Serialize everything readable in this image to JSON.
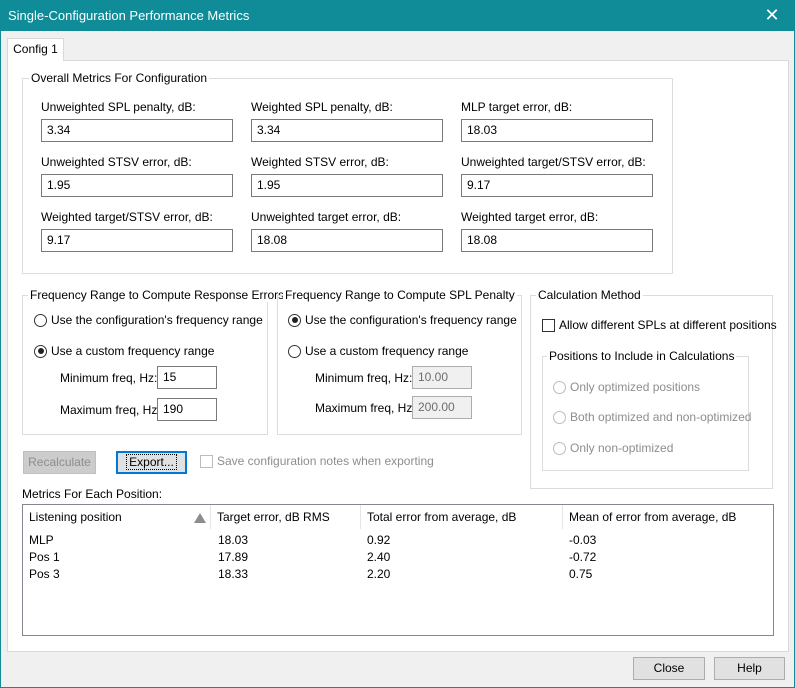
{
  "window": {
    "title": "Single-Configuration Performance Metrics",
    "close_glyph": "✕"
  },
  "tabs": [
    {
      "label": "Config 1"
    }
  ],
  "overall": {
    "legend": "Overall Metrics For Configuration",
    "fields": [
      {
        "label": "Unweighted SPL penalty, dB:",
        "value": "3.34"
      },
      {
        "label": "Weighted SPL penalty, dB:",
        "value": "3.34"
      },
      {
        "label": "MLP target error, dB:",
        "value": "18.03"
      },
      {
        "label": "Unweighted STSV error, dB:",
        "value": "1.95"
      },
      {
        "label": "Weighted STSV error, dB:",
        "value": "1.95"
      },
      {
        "label": "Unweighted target/STSV error, dB:",
        "value": "9.17"
      },
      {
        "label": "Weighted target/STSV error, dB:",
        "value": "9.17"
      },
      {
        "label": "Unweighted target error, dB:",
        "value": "18.08"
      },
      {
        "label": "Weighted target error, dB:",
        "value": "18.08"
      }
    ]
  },
  "resp_range": {
    "legend": "Frequency Range to Compute Response Errors",
    "opt1": "Use the configuration's frequency range",
    "opt2": "Use a custom frequency range",
    "min_label": "Minimum freq, Hz:",
    "min_value": "15",
    "max_label": "Maximum freq, Hz:",
    "max_value": "190"
  },
  "spl_range": {
    "legend": "Frequency Range to Compute SPL Penalty",
    "opt1": "Use the configuration's frequency range",
    "opt2": "Use a custom frequency range",
    "min_label": "Minimum freq, Hz:",
    "min_value": "10.00",
    "max_label": "Maximum freq, Hz:",
    "max_value": "200.00"
  },
  "calc": {
    "legend": "Calculation Method",
    "allow_label": "Allow different SPLs at different positions",
    "positions_legend": "Positions to Include in Calculations",
    "p1": "Only optimized positions",
    "p2": "Both optimized and non-optimized",
    "p3": "Only non-optimized"
  },
  "actions": {
    "recalculate": "Recalculate",
    "export": "Export...",
    "save_notes": "Save configuration notes when exporting"
  },
  "positions": {
    "title": "Metrics For Each Position:",
    "columns": [
      "Listening position",
      "Target error, dB RMS",
      "Total error from average, dB",
      "Mean of error from average, dB"
    ],
    "rows": [
      [
        "MLP",
        "18.03",
        "0.92",
        "-0.03"
      ],
      [
        "Pos 1",
        "17.89",
        "2.40",
        "-0.72"
      ],
      [
        "Pos 3",
        "18.33",
        "2.20",
        "0.75"
      ]
    ]
  },
  "footer": {
    "close": "Close",
    "help": "Help"
  },
  "colors": {
    "titlebar": "#0f8c98",
    "panel": "#ffffff",
    "dialog": "#f0f0f0"
  }
}
